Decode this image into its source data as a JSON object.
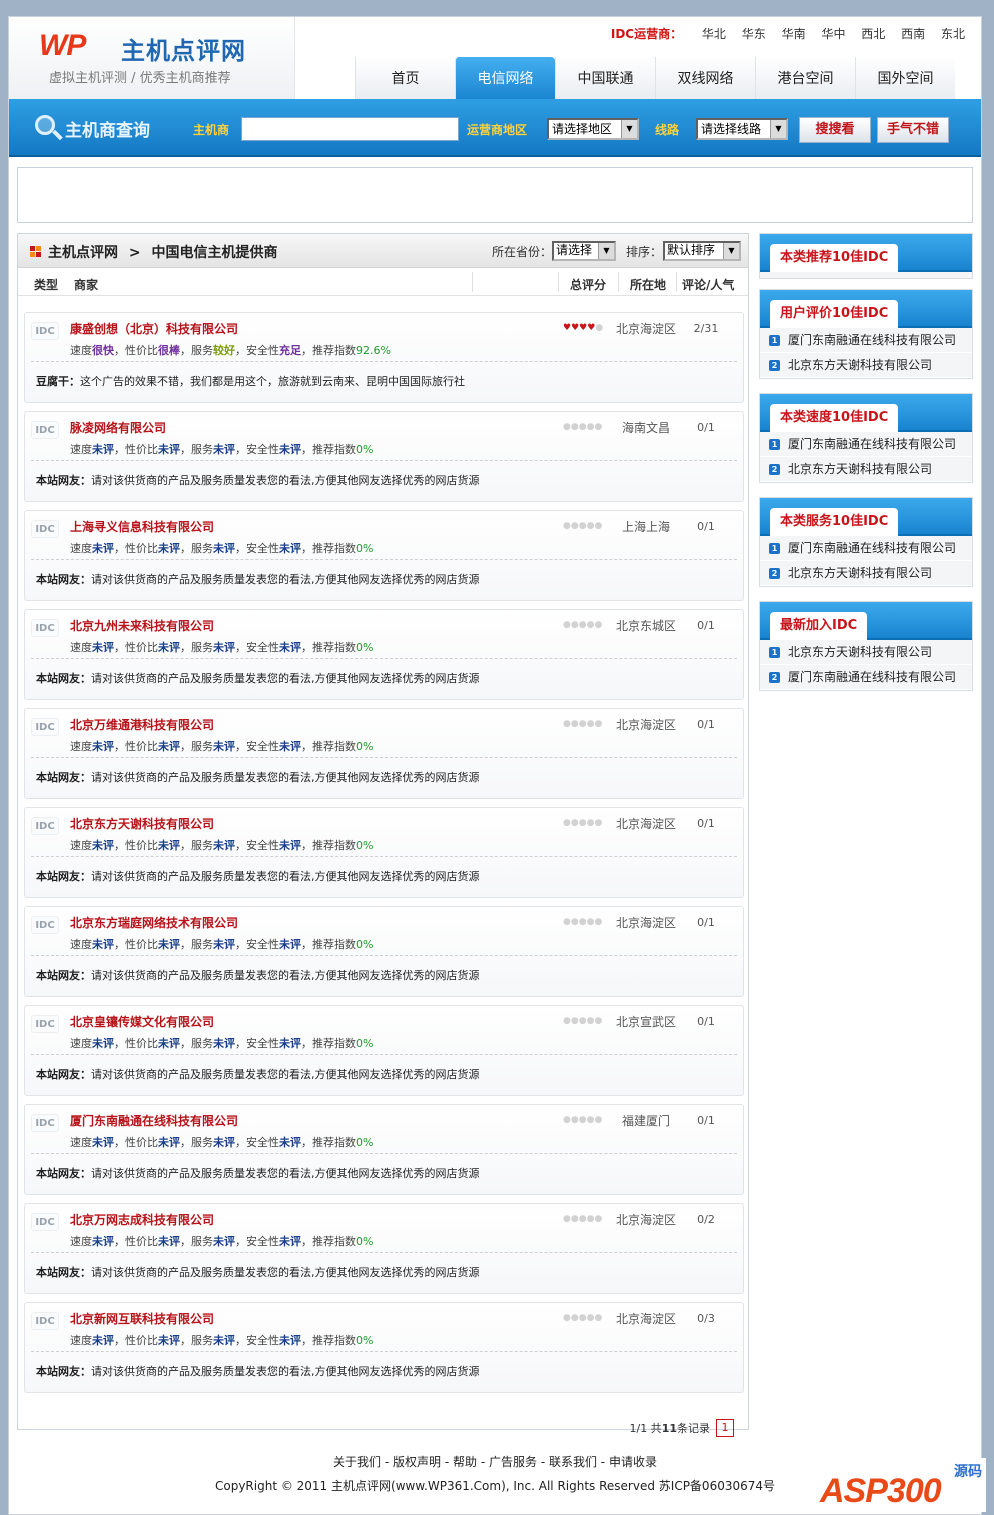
{
  "header": {
    "logo_mark": "WP",
    "logo_title": "主机点评网",
    "logo_subtitle": "虚拟主机评测 / 优秀主机商推荐",
    "operators_label": "IDC运营商：",
    "operators": [
      "华北",
      "华东",
      "华南",
      "华中",
      "西北",
      "西南",
      "东北"
    ]
  },
  "nav": [
    "首页",
    "电信网络",
    "中国联通",
    "双线网络",
    "港台空间",
    "国外空间"
  ],
  "nav_active": "电信网络",
  "search": {
    "title": "主机商查询",
    "host_label": "主机商",
    "host_value": "",
    "region_label": "运营商地区",
    "region_select": "请选择地区",
    "line_label": "线路",
    "line_select": "请选择线路",
    "search_button": "搜搜看",
    "lucky_button": "手气不错"
  },
  "main": {
    "breadcrumb_home": "主机点评网",
    "breadcrumb_sep": ">",
    "breadcrumb_current": "中国电信主机提供商",
    "province_label": "所在省份：",
    "province_select": "请选择",
    "sort_label": "排序：",
    "sort_select": "默认排序",
    "columns": {
      "type": "类型",
      "merchant": "商家",
      "score": "总评分",
      "location": "所在地",
      "stats": "评论/人气"
    },
    "badge": "IDC",
    "labels": {
      "speed": "速度",
      "value": "性价比",
      "service": "服务",
      "security": "安全性",
      "recommend": "推荐指数",
      "sep": "，"
    },
    "entries": [
      {
        "name": "康盛创想（北京）科技有限公司",
        "speed": "很快",
        "value": "很棒",
        "service": "较好",
        "security": "充足",
        "recommend": "92.6%",
        "stars": 4,
        "location": "北京海淀区",
        "stats": "2/31",
        "commenter": "豆腐干：",
        "comment": "这个广告的效果不错，我们都是用这个，旅游就到云南来、昆明中国国际旅行社"
      },
      {
        "name": "脉凌网络有限公司",
        "speed": "未评",
        "value": "未评",
        "service": "未评",
        "security": "未评",
        "recommend": "0%",
        "stars": 0,
        "location": "海南文昌",
        "stats": "0/1",
        "commenter": "本站网友：",
        "comment": "请对该供货商的产品及服务质量发表您的看法,方便其他网友选择优秀的网店货源"
      },
      {
        "name": "上海寻义信息科技有限公司",
        "speed": "未评",
        "value": "未评",
        "service": "未评",
        "security": "未评",
        "recommend": "0%",
        "stars": 0,
        "location": "上海上海",
        "stats": "0/1",
        "commenter": "本站网友：",
        "comment": "请对该供货商的产品及服务质量发表您的看法,方便其他网友选择优秀的网店货源"
      },
      {
        "name": "北京九州未来科技有限公司",
        "speed": "未评",
        "value": "未评",
        "service": "未评",
        "security": "未评",
        "recommend": "0%",
        "stars": 0,
        "location": "北京东城区",
        "stats": "0/1",
        "commenter": "本站网友：",
        "comment": "请对该供货商的产品及服务质量发表您的看法,方便其他网友选择优秀的网店货源"
      },
      {
        "name": "北京万维通港科技有限公司",
        "speed": "未评",
        "value": "未评",
        "service": "未评",
        "security": "未评",
        "recommend": "0%",
        "stars": 0,
        "location": "北京海淀区",
        "stats": "0/1",
        "commenter": "本站网友：",
        "comment": "请对该供货商的产品及服务质量发表您的看法,方便其他网友选择优秀的网店货源"
      },
      {
        "name": "北京东方天谢科技有限公司",
        "speed": "未评",
        "value": "未评",
        "service": "未评",
        "security": "未评",
        "recommend": "0%",
        "stars": 0,
        "location": "北京海淀区",
        "stats": "0/1",
        "commenter": "本站网友：",
        "comment": "请对该供货商的产品及服务质量发表您的看法,方便其他网友选择优秀的网店货源"
      },
      {
        "name": "北京东方瑞庭网络技术有限公司",
        "speed": "未评",
        "value": "未评",
        "service": "未评",
        "security": "未评",
        "recommend": "0%",
        "stars": 0,
        "location": "北京海淀区",
        "stats": "0/1",
        "commenter": "本站网友：",
        "comment": "请对该供货商的产品及服务质量发表您的看法,方便其他网友选择优秀的网店货源"
      },
      {
        "name": "北京皇镶传媒文化有限公司",
        "speed": "未评",
        "value": "未评",
        "service": "未评",
        "security": "未评",
        "recommend": "0%",
        "stars": 0,
        "location": "北京宣武区",
        "stats": "0/1",
        "commenter": "本站网友：",
        "comment": "请对该供货商的产品及服务质量发表您的看法,方便其他网友选择优秀的网店货源"
      },
      {
        "name": "厦门东南融通在线科技有限公司",
        "speed": "未评",
        "value": "未评",
        "service": "未评",
        "security": "未评",
        "recommend": "0%",
        "stars": 0,
        "location": "福建厦门",
        "stats": "0/1",
        "commenter": "本站网友：",
        "comment": "请对该供货商的产品及服务质量发表您的看法,方便其他网友选择优秀的网店货源"
      },
      {
        "name": "北京万网志成科技有限公司",
        "speed": "未评",
        "value": "未评",
        "service": "未评",
        "security": "未评",
        "recommend": "0%",
        "stars": 0,
        "location": "北京海淀区",
        "stats": "0/2",
        "commenter": "本站网友：",
        "comment": "请对该供货商的产品及服务质量发表您的看法,方便其他网友选择优秀的网店货源"
      },
      {
        "name": "北京新网互联科技有限公司",
        "speed": "未评",
        "value": "未评",
        "service": "未评",
        "security": "未评",
        "recommend": "0%",
        "stars": 0,
        "location": "北京海淀区",
        "stats": "0/3",
        "commenter": "本站网友：",
        "comment": "请对该供货商的产品及服务质量发表您的看法,方便其他网友选择优秀的网店货源"
      }
    ],
    "pager": {
      "summary_prefix": "1/1 共",
      "total": "11",
      "summary_suffix": "条记录",
      "current_page": "1"
    }
  },
  "sidebar": [
    {
      "title": "本类推荐10佳IDC",
      "items": []
    },
    {
      "title": "用户评价10佳IDC",
      "items": [
        "厦门东南融通在线科技有限公司",
        "北京东方天谢科技有限公司"
      ]
    },
    {
      "title": "本类速度10佳IDC",
      "items": [
        "厦门东南融通在线科技有限公司",
        "北京东方天谢科技有限公司"
      ]
    },
    {
      "title": "本类服务10佳IDC",
      "items": [
        "厦门东南融通在线科技有限公司",
        "北京东方天谢科技有限公司"
      ]
    },
    {
      "title": "最新加入IDC",
      "items": [
        "北京东方天谢科技有限公司",
        "厦门东南融通在线科技有限公司"
      ]
    }
  ],
  "footer": {
    "links": [
      "关于我们",
      "版权声明",
      "帮助",
      "广告服务",
      "联系我们",
      "申请收录"
    ],
    "link_sep": " - ",
    "copyright": "CopyRight © 2011 主机点评网(www.WP361.Com), Inc. All Rights Reserved 苏ICP备06030674号"
  },
  "watermark": {
    "brand": "ASP300",
    "code": "源码"
  },
  "colors": {
    "accent_blue": "#1884cf",
    "name_red": "#b81319",
    "star_on": "#c8141a",
    "good_green": "#1c9c28"
  }
}
